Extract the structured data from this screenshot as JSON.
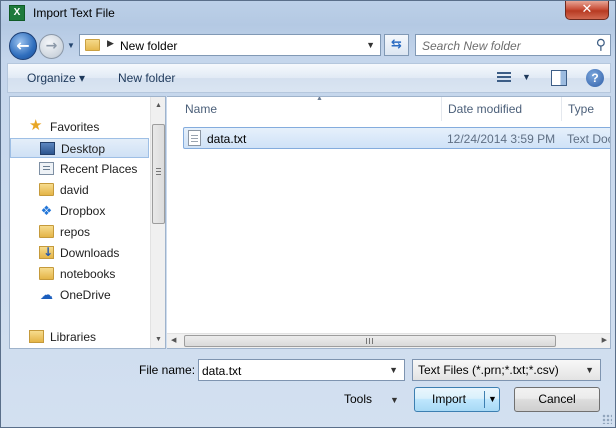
{
  "window": {
    "title": "Import Text File",
    "app_icon_letter": "X",
    "close_glyph": "✕"
  },
  "address_bar": {
    "back_glyph": "←",
    "forward_glyph": "→",
    "recent_glyph": "▼",
    "separator_glyph": "▶",
    "path": "New folder",
    "dropdown_glyph": "▼",
    "refresh_glyph": "⇆"
  },
  "search": {
    "placeholder": "Search New folder",
    "icon": "search-icon",
    "icon_glyph": "⚲"
  },
  "toolbar": {
    "organize_label": "Organize ▾",
    "new_folder_label": "New folder",
    "views_dropdown_glyph": "▼",
    "help_glyph": "?"
  },
  "nav_pane": {
    "favorites_label": "Favorites",
    "items": [
      {
        "label": "Desktop",
        "icon": "desktop-icon",
        "selected": true
      },
      {
        "label": "Recent Places",
        "icon": "recent-places-icon"
      },
      {
        "label": "david",
        "icon": "folder-icon"
      },
      {
        "label": "Dropbox",
        "icon": "dropbox-icon"
      },
      {
        "label": "repos",
        "icon": "folder-icon"
      },
      {
        "label": "Downloads",
        "icon": "downloads-icon"
      },
      {
        "label": "notebooks",
        "icon": "folder-icon"
      },
      {
        "label": "OneDrive",
        "icon": "onedrive-icon"
      }
    ],
    "libraries_label": "Libraries",
    "scroll_up_glyph": "▲",
    "scroll_down_glyph": "▼"
  },
  "file_list": {
    "columns": [
      "Name",
      "Date modified",
      "Type"
    ],
    "sort_glyph": "▲",
    "rows": [
      {
        "name": "data.txt",
        "date_modified": "12/24/2014 3:59 PM",
        "type": "Text Docu",
        "selected": true
      }
    ],
    "scroll_left_glyph": "◀",
    "scroll_right_glyph": "▶"
  },
  "footer": {
    "file_name_label": "File name:",
    "file_name_value": "data.txt",
    "file_name_dropdown_glyph": "▼",
    "file_type_value": "Text Files (*.prn;*.txt;*.csv)",
    "file_type_dropdown_glyph": "▼",
    "tools_label": "Tools",
    "tools_dropdown_glyph": "▼",
    "import_label": "Import",
    "import_dropdown_glyph": "▼",
    "cancel_label": "Cancel"
  },
  "colors": {
    "window_chrome": "#bcd0e8",
    "selection_fill": "#cfe2f7",
    "selection_border": "#84acdd",
    "close_button": "#c9503a",
    "import_button": "#bee6fd"
  }
}
